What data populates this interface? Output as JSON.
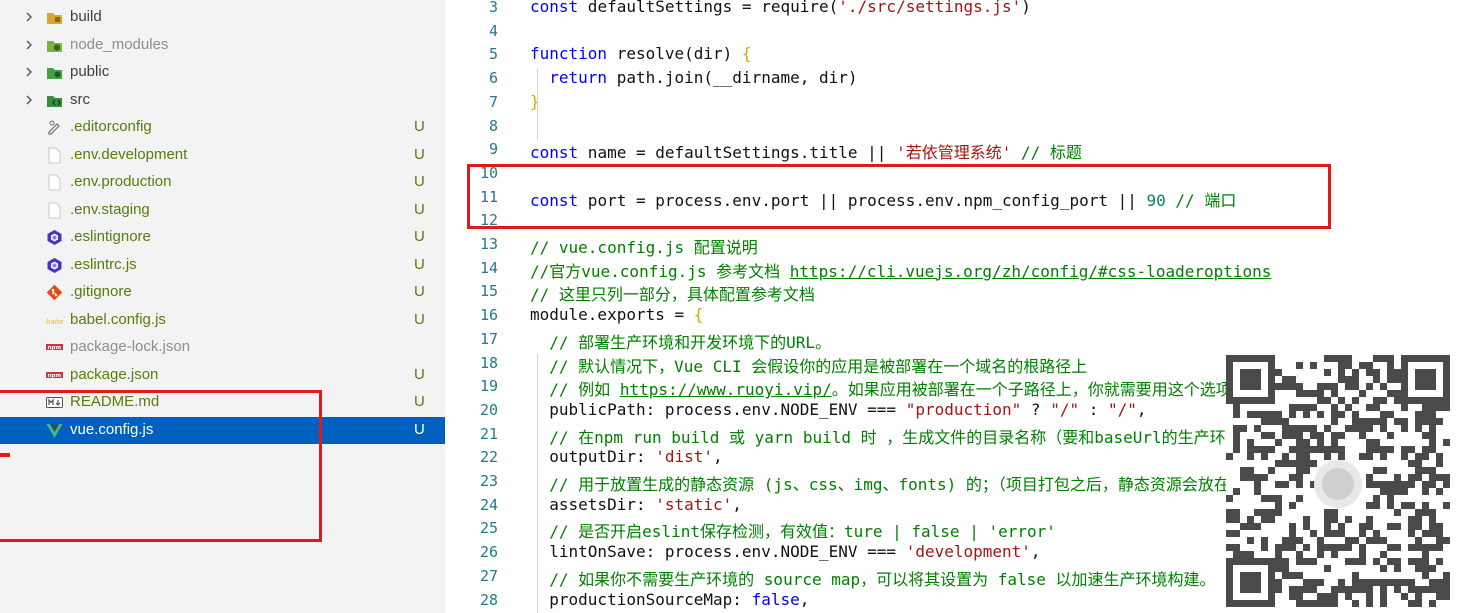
{
  "explorer": {
    "items": [
      {
        "name": "build",
        "type": "folder",
        "icon": "build-folder-icon",
        "status": "normal",
        "badge": ""
      },
      {
        "name": "node_modules",
        "type": "folder",
        "icon": "node-folder-icon",
        "status": "ignored",
        "badge": ""
      },
      {
        "name": "public",
        "type": "folder",
        "icon": "public-folder-icon",
        "status": "normal",
        "badge": ""
      },
      {
        "name": "src",
        "type": "folder",
        "icon": "src-folder-icon",
        "status": "normal",
        "badge": ""
      },
      {
        "name": ".editorconfig",
        "type": "file",
        "icon": "editorconfig-icon",
        "status": "untracked",
        "badge": "U"
      },
      {
        "name": ".env.development",
        "type": "file",
        "icon": "file-icon",
        "status": "untracked",
        "badge": "U"
      },
      {
        "name": ".env.production",
        "type": "file",
        "icon": "file-icon",
        "status": "untracked",
        "badge": "U"
      },
      {
        "name": ".env.staging",
        "type": "file",
        "icon": "file-icon",
        "status": "untracked",
        "badge": "U"
      },
      {
        "name": ".eslintignore",
        "type": "file",
        "icon": "eslint-icon",
        "status": "untracked",
        "badge": "U"
      },
      {
        "name": ".eslintrc.js",
        "type": "file",
        "icon": "eslint-icon",
        "status": "untracked",
        "badge": "U"
      },
      {
        "name": ".gitignore",
        "type": "file",
        "icon": "git-icon",
        "status": "untracked",
        "badge": "U"
      },
      {
        "name": "babel.config.js",
        "type": "file",
        "icon": "babel-icon",
        "status": "untracked",
        "badge": "U"
      },
      {
        "name": "package-lock.json",
        "type": "file",
        "icon": "npm-icon",
        "status": "ignored",
        "badge": ""
      },
      {
        "name": "package.json",
        "type": "file",
        "icon": "npm-icon",
        "status": "untracked",
        "badge": "U"
      },
      {
        "name": "README.md",
        "type": "file",
        "icon": "markdown-icon",
        "status": "untracked",
        "badge": "U"
      },
      {
        "name": "vue.config.js",
        "type": "file",
        "icon": "vue-icon",
        "status": "untracked",
        "badge": "U",
        "selected": true
      }
    ]
  },
  "editor": {
    "lines": [
      {
        "n": "3",
        "tokens": [
          [
            "kw",
            "const"
          ],
          [
            "id",
            " defaultSettings = require("
          ],
          [
            "str",
            "'./src/settings.js'"
          ],
          [
            "id",
            ")"
          ]
        ]
      },
      {
        "n": "4",
        "tokens": []
      },
      {
        "n": "5",
        "tokens": [
          [
            "kw",
            "function"
          ],
          [
            "id",
            " resolve(dir) "
          ],
          [
            "brk",
            "{"
          ]
        ]
      },
      {
        "n": "6",
        "tokens": [
          [
            "id",
            "  "
          ],
          [
            "kw",
            "return"
          ],
          [
            "id",
            " path.join("
          ],
          [
            "id",
            "__dirname, dir)"
          ]
        ]
      },
      {
        "n": "7",
        "tokens": [
          [
            "brk",
            "}"
          ]
        ]
      },
      {
        "n": "8",
        "tokens": []
      },
      {
        "n": "9",
        "tokens": [
          [
            "kw",
            "const"
          ],
          [
            "id",
            " name = defaultSettings.title || "
          ],
          [
            "str",
            "'若依管理系统'"
          ],
          [
            "cmt",
            " // 标题"
          ]
        ]
      },
      {
        "n": "10",
        "tokens": []
      },
      {
        "n": "11",
        "tokens": [
          [
            "kw",
            "const"
          ],
          [
            "id",
            " port = process.env.port || process.env.npm_config_port || "
          ],
          [
            "num",
            "90"
          ],
          [
            "cmt",
            " // 端口"
          ]
        ]
      },
      {
        "n": "12",
        "tokens": []
      },
      {
        "n": "13",
        "tokens": [
          [
            "cmt",
            "// vue.config.js 配置说明"
          ]
        ]
      },
      {
        "n": "14",
        "tokens": [
          [
            "cmt",
            "//官方vue.config.js 参考文档 "
          ],
          [
            "link",
            "https://cli.vuejs.org/zh/config/#css-loaderoptions"
          ]
        ]
      },
      {
        "n": "15",
        "tokens": [
          [
            "cmt",
            "// 这里只列一部分，具体配置参考文档"
          ]
        ]
      },
      {
        "n": "16",
        "tokens": [
          [
            "id",
            "module.exports = "
          ],
          [
            "brk",
            "{"
          ]
        ]
      },
      {
        "n": "17",
        "tokens": [
          [
            "id",
            "  "
          ],
          [
            "cmt",
            "// 部署生产环境和开发环境下的URL。"
          ]
        ]
      },
      {
        "n": "18",
        "tokens": [
          [
            "id",
            "  "
          ],
          [
            "cmt",
            "// 默认情况下，Vue CLI 会假设你的应用是被部署在一个域名的根路径上"
          ]
        ]
      },
      {
        "n": "19",
        "tokens": [
          [
            "id",
            "  "
          ],
          [
            "cmt",
            "// 例如 "
          ],
          [
            "link",
            "https://www.ruoyi.vip/"
          ],
          [
            "cmt",
            "。如果应用被部署在一个子路径上，你就需要用这个选项指定这个子路径。例如，"
          ]
        ]
      },
      {
        "n": "20",
        "tokens": [
          [
            "id",
            "  publicPath: process.env.NODE_ENV === "
          ],
          [
            "str",
            "\"production\""
          ],
          [
            "id",
            " ? "
          ],
          [
            "str",
            "\"/\""
          ],
          [
            "id",
            " : "
          ],
          [
            "str",
            "\"/\""
          ],
          [
            "id",
            ","
          ]
        ]
      },
      {
        "n": "21",
        "tokens": [
          [
            "id",
            "  "
          ],
          [
            "cmt",
            "// 在npm run build 或 yarn build 时 ，生成文件的目录名称（要和baseUrl的生产环境路径一致）（默认dist）"
          ]
        ]
      },
      {
        "n": "22",
        "tokens": [
          [
            "id",
            "  outputDir: "
          ],
          [
            "str",
            "'dist'"
          ],
          [
            "id",
            ","
          ]
        ]
      },
      {
        "n": "23",
        "tokens": [
          [
            "id",
            "  "
          ],
          [
            "cmt",
            "// 用于放置生成的静态资源 (js、css、img、fonts) 的；（项目打包之后，静态资源会放在这个文件夹下）"
          ]
        ]
      },
      {
        "n": "24",
        "tokens": [
          [
            "id",
            "  assetsDir: "
          ],
          [
            "str",
            "'static'"
          ],
          [
            "id",
            ","
          ]
        ]
      },
      {
        "n": "25",
        "tokens": [
          [
            "id",
            "  "
          ],
          [
            "cmt",
            "// 是否开启eslint保存检测，有效值：ture | false | 'error'"
          ]
        ]
      },
      {
        "n": "26",
        "tokens": [
          [
            "id",
            "  lintOnSave: process.env.NODE_ENV === "
          ],
          [
            "str",
            "'development'"
          ],
          [
            "id",
            ","
          ]
        ]
      },
      {
        "n": "27",
        "tokens": [
          [
            "id",
            "  "
          ],
          [
            "cmt",
            "// 如果你不需要生产环境的 source map，可以将其设置为 false 以加速生产环境构建。"
          ]
        ]
      },
      {
        "n": "28",
        "tokens": [
          [
            "id",
            "  productionSourceMap: "
          ],
          [
            "kw",
            "false"
          ],
          [
            "id",
            ","
          ]
        ]
      }
    ]
  },
  "colors": {
    "selection": "#0060c0",
    "highlight_box": "#e0191b",
    "untracked": "#587c0c",
    "keyword": "#0000ff",
    "string": "#a31515",
    "comment": "#008000",
    "number": "#098658"
  }
}
